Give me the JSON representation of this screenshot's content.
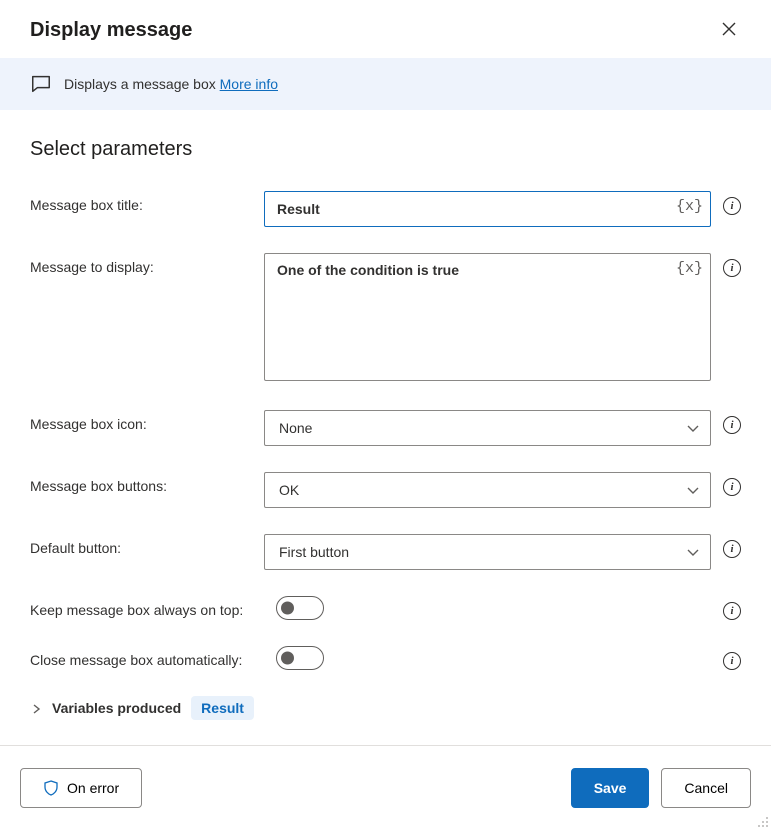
{
  "dialog": {
    "title": "Display message",
    "close_aria": "Close"
  },
  "banner": {
    "text": "Displays a message box ",
    "link": "More info"
  },
  "section": {
    "title": "Select parameters"
  },
  "fields": {
    "title": {
      "label": "Message box title:",
      "value": "Result"
    },
    "message": {
      "label": "Message to display:",
      "value": "One of the condition is true"
    },
    "icon": {
      "label": "Message box icon:",
      "value": "None"
    },
    "buttons_choice": {
      "label": "Message box buttons:",
      "value": "OK"
    },
    "default_btn": {
      "label": "Default button:",
      "value": "First button"
    },
    "always_top": {
      "label": "Keep message box always on top:",
      "value": false
    },
    "auto_close": {
      "label": "Close message box automatically:",
      "value": false
    }
  },
  "var_token": "{x}",
  "variables": {
    "label": "Variables produced",
    "badge": "Result"
  },
  "buttons": {
    "on_error": "On error",
    "save": "Save",
    "cancel": "Cancel"
  }
}
